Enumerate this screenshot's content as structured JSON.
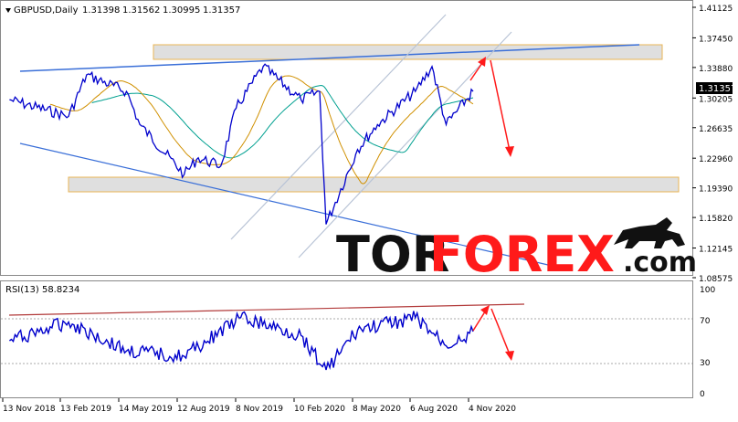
{
  "chart_data": [
    {
      "type": "line",
      "title": "GBPUSD,Daily",
      "ohlc_header": {
        "open": "1.31398",
        "high": "1.31562",
        "low": "1.30995",
        "close": "1.31357"
      },
      "current_price_label": "1.31357",
      "y_ticks": [
        "1.41125",
        "1.37450",
        "1.33880",
        "1.30205",
        "1.26635",
        "1.22960",
        "1.19390",
        "1.15820",
        "1.12145",
        "1.08575"
      ],
      "ylim": [
        1.08575,
        1.41125
      ],
      "x_ticks": [
        "13 Nov 2018",
        "13 Feb 2019",
        "14 May 2019",
        "12 Aug 2019",
        "8 Nov 2019",
        "10 Feb 2020",
        "8 May 2020",
        "6 Aug 2020",
        "4 Nov 2020"
      ],
      "grid": false,
      "series": [
        {
          "name": "GBPUSD",
          "color": "#0000cc",
          "x": [
            "13 Nov 2018",
            "13 Feb 2019",
            "13 Mar 2019",
            "14 May 2019",
            "4 Jun 2019",
            "12 Aug 2019",
            "3 Sep 2019",
            "8 Oct 2019",
            "1 Nov 2019",
            "13 Dec 2019",
            "10 Feb 2020",
            "10 Mar 2020",
            "20 Mar 2020",
            "8 May 2020",
            "8 Jun 2020",
            "6 Aug 2020",
            "1 Sep 2020",
            "23 Sep 2020",
            "4 Nov 2020"
          ],
          "values": [
            1.3,
            1.28,
            1.33,
            1.31,
            1.27,
            1.21,
            1.23,
            1.22,
            1.29,
            1.34,
            1.3,
            1.31,
            1.15,
            1.24,
            1.27,
            1.31,
            1.34,
            1.27,
            1.31
          ]
        },
        {
          "name": "moving average (teal)",
          "color": "#00a090"
        },
        {
          "name": "moving average (orange)",
          "color": "#d09000"
        }
      ],
      "annotations": [
        {
          "type": "resistance-zone",
          "from": 1.345,
          "to": 1.356
        },
        {
          "type": "support-zone",
          "from": 1.195,
          "to": 1.205
        },
        {
          "type": "forecast-arrows",
          "color": "#e03030"
        }
      ]
    },
    {
      "type": "line",
      "title": "RSI(13) 58.8234",
      "ylim": [
        0,
        100
      ],
      "y_ticks": [
        "100",
        "70",
        "30",
        "0"
      ],
      "levels": [
        70,
        30
      ],
      "series": [
        {
          "name": "RSI(13)",
          "color": "#0000cc",
          "x": [
            "13 Nov 2018",
            "13 Feb 2019",
            "14 May 2019",
            "12 Aug 2019",
            "8 Nov 2019",
            "10 Feb 2020",
            "20 Mar 2020",
            "8 May 2020",
            "6 Aug 2020",
            "23 Sep 2020",
            "4 Nov 2020"
          ],
          "values": [
            50,
            68,
            40,
            35,
            72,
            55,
            22,
            60,
            72,
            45,
            58.8
          ]
        }
      ]
    }
  ],
  "watermark": {
    "brand_dark": "TOR",
    "brand_red": "FOREX",
    "suffix": ".com"
  },
  "colors": {
    "accent": "#ff1a1a",
    "price": "#0000cc",
    "trend": "#3a6fd8",
    "channel": "#b9c4d6",
    "resistance": "#b23a3a"
  }
}
